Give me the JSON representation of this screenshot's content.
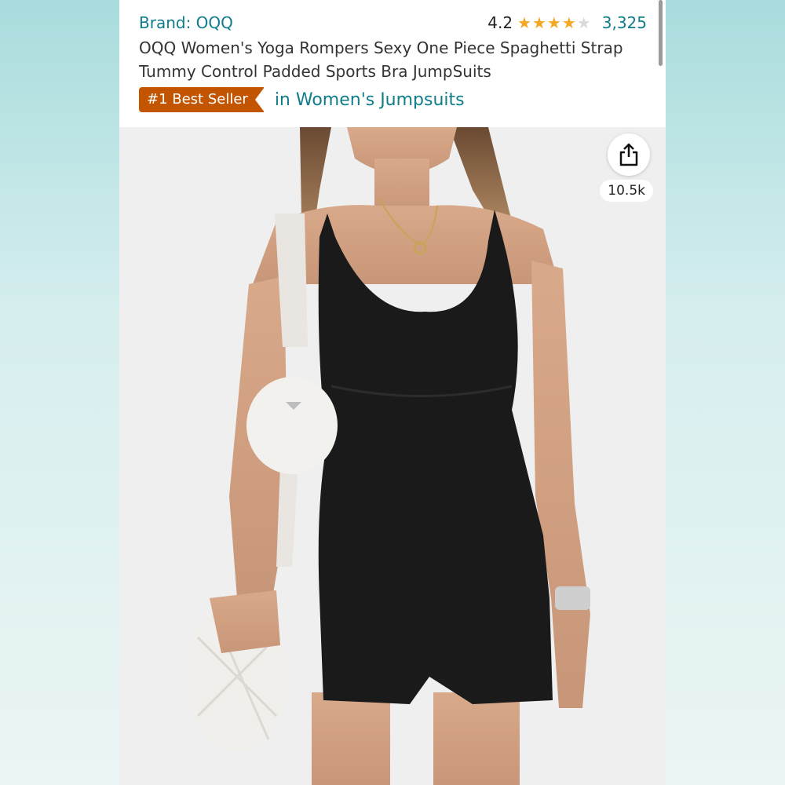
{
  "header": {
    "brand": "Brand: OQQ",
    "rating_value": "4.2",
    "rating_stars": 4.2,
    "review_count": "3,325",
    "title": "OQQ Women's Yoga Rompers Sexy One Piece Spaghetti Strap Tummy Control Padded Sports Bra JumpSuits",
    "badge": "#1 Best Seller",
    "category": "in Women's Jumpsuits"
  },
  "share": {
    "icon": "share-icon",
    "count": "10.5k"
  },
  "colors": {
    "link": "#0f7d8a",
    "badge": "#c45500",
    "star": "#f5a623"
  }
}
